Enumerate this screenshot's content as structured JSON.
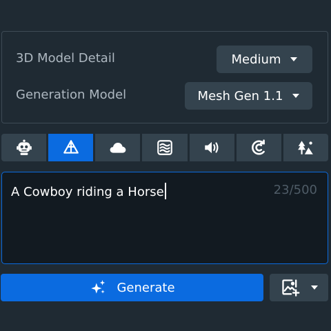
{
  "settings": {
    "detail_label": "3D Model Detail",
    "detail_value": "Medium",
    "model_label": "Generation Model",
    "model_value": "Mesh Gen 1.1"
  },
  "tabs": [
    {
      "icon": "robot-icon",
      "active": false
    },
    {
      "icon": "mesh-pyramid-icon",
      "active": true
    },
    {
      "icon": "cloud-icon",
      "active": false
    },
    {
      "icon": "waves-icon",
      "active": false
    },
    {
      "icon": "sound-icon",
      "active": false
    },
    {
      "icon": "refresh-c-icon",
      "active": false
    },
    {
      "icon": "landscape-icon",
      "active": false
    }
  ],
  "prompt": {
    "text": "A Cowboy riding a Horse",
    "count": "23/500"
  },
  "generate": {
    "label": "Generate"
  },
  "colors": {
    "accent": "#0b6be0",
    "background": "#1f2a33",
    "control": "#34434e"
  }
}
